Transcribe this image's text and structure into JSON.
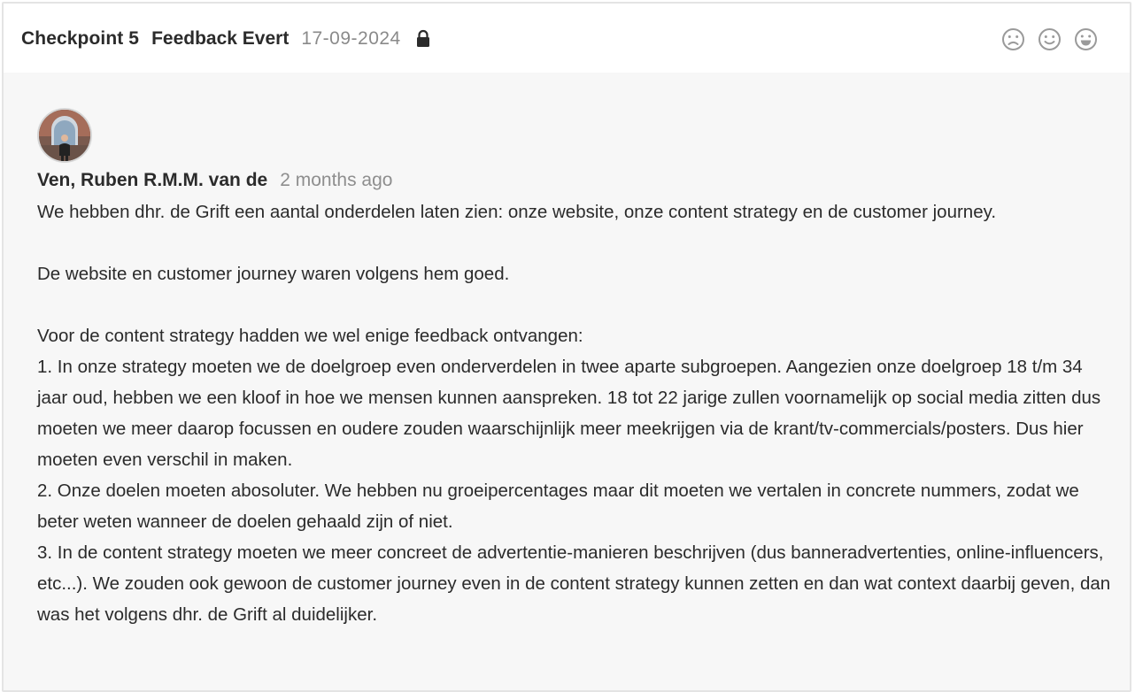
{
  "header": {
    "checkpoint": "Checkpoint 5",
    "title": "Feedback Evert",
    "date": "17-09-2024",
    "lock_icon": "lock-icon",
    "reactions": [
      "frown-icon",
      "smile-icon",
      "grin-icon"
    ]
  },
  "comment": {
    "author": "Ven, Ruben R.M.M. van de",
    "time_ago": "2 months ago",
    "paragraphs": [
      "We hebben dhr. de Grift een aantal onderdelen laten zien: onze website, onze content strategy en de customer journey.",
      "De website en customer journey waren volgens hem goed.",
      "Voor de content strategy hadden we wel enige feedback ontvangen:\n1. In onze strategy moeten we de doelgroep even onderverdelen in twee aparte subgroepen. Aangezien onze doelgroep 18 t/m 34 jaar oud, hebben we een kloof in hoe we mensen kunnen aanspreken. 18 tot 22 jarige zullen voornamelijk op social media zitten dus moeten we meer daarop focussen en oudere zouden waarschijnlijk meer meekrijgen via de krant/tv-commercials/posters. Dus hier moeten even verschil in maken.\n2. Onze doelen moeten abosoluter. We hebben nu groeipercentages maar dit moeten we vertalen in concrete nummers, zodat we beter weten wanneer de doelen gehaald zijn of niet.\n3. In de content strategy moeten we meer concreet de advertentie-manieren beschrijven (dus banneradvertenties, online-influencers, etc...). We zouden ook gewoon de customer journey even in de content strategy kunnen zetten en dan wat context daarbij geven, dan was het volgens dhr. de Grift al duidelijker."
    ]
  },
  "colors": {
    "text": "#2b2b2b",
    "muted": "#8a8a8a",
    "body_bg": "#f7f7f7",
    "border": "#e4e4e4"
  }
}
